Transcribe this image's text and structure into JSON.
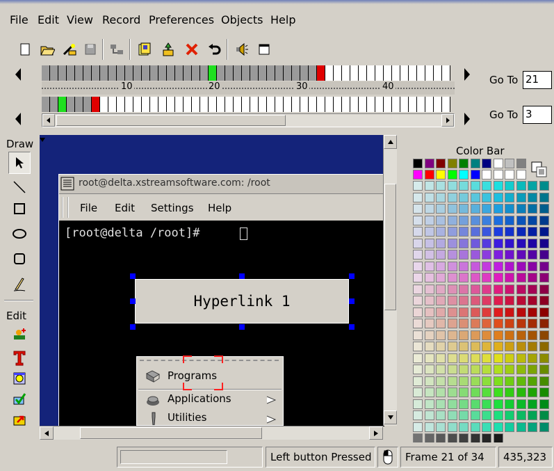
{
  "menubar": {
    "items": [
      "File",
      "Edit",
      "View",
      "Record",
      "Preferences",
      "Objects",
      "Help"
    ]
  },
  "toolbar": {
    "icons": [
      "new-icon",
      "open-icon",
      "wizard-icon",
      "save-icon",
      "settings-icon",
      "frame-icon",
      "props-icon",
      "delete-icon",
      "undo-icon",
      "audio-icon",
      "window-icon"
    ]
  },
  "timeline": {
    "ruler_ticks": [
      "10",
      "20",
      "30",
      "40"
    ],
    "top_current_frame": 21,
    "top_total_frames": 34,
    "bottom_current_frame": 3,
    "goto_label": "Go To",
    "goto_top_value": "21",
    "goto_bottom_value": "3"
  },
  "tools": {
    "draw_label": "Draw",
    "edit_label": "Edit"
  },
  "canvas": {
    "terminal_title": "root@delta.xstreamsoftware.com: /root",
    "terminal_menu": [
      "File",
      "Edit",
      "Settings",
      "Help"
    ],
    "prompt": "[root@delta /root]# ",
    "hyperlink_label": "Hyperlink 1",
    "popup_items": [
      "Programs",
      "Applications",
      "Utilities"
    ]
  },
  "colorbar": {
    "title": "Color Bar",
    "top_row_colors": [
      "#000000",
      "#800080",
      "#800000",
      "#808000",
      "#008000",
      "#008080",
      "#000080",
      "#ffffff",
      "#c0c0c0",
      "#808080"
    ],
    "second_row_colors": [
      "#ff00ff",
      "#ff0000",
      "#ffff00",
      "#00ff00",
      "#00ffff",
      "#0000ff",
      "#ffffff",
      "#ffffff",
      "#ffffff",
      "#ffffff"
    ]
  },
  "status": {
    "message": "Left button Pressed",
    "frame": "Frame 21 of 34",
    "coords": "435,323"
  }
}
